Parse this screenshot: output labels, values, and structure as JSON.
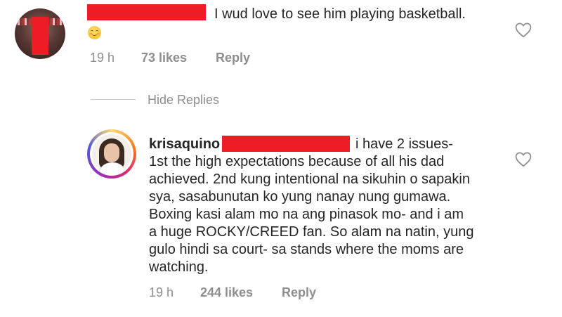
{
  "comment1": {
    "text": "I wud love to see him playing basketball.",
    "emoji_icon": "relieved-face-emoji",
    "time": "19 h",
    "likes": "73 likes",
    "reply_label": "Reply",
    "redaction_color": "#ee1c25"
  },
  "replies_toggle": {
    "label": "Hide Replies"
  },
  "comment2": {
    "username": "krisaquino",
    "lines": [
      "i have 2 issues-",
      "1st the high expectations because of all his dad",
      "achieved. 2nd kung intentional na sikuhin o sapakin",
      "sya, sasabunutan ko yung nanay nung gumawa.",
      "Boxing kasi alam mo na ang pinasok mo- and i am",
      "a huge ROCKY/CREED fan. So alam na natin, yung",
      "gulo hindi sa court- sa stands where the moms are",
      "watching."
    ],
    "time": "19 h",
    "likes": "244 likes",
    "reply_label": "Reply",
    "story_ring_colors": [
      "#feda75",
      "#fa7e1e",
      "#d62976",
      "#962fbf",
      "#4f5bd5"
    ]
  },
  "icons": {
    "like": "heart-outline-icon"
  }
}
